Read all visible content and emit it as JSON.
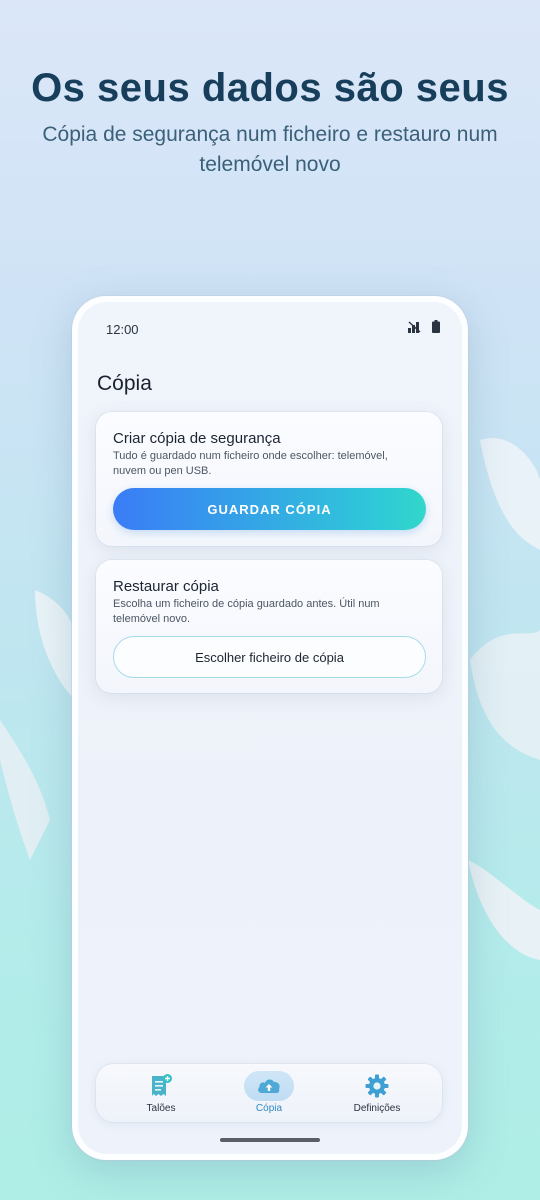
{
  "headline": "Os seus dados são seus",
  "subline": "Cópia de segurança num ficheiro e restauro num telemóvel novo",
  "phone": {
    "status_time": "12:00",
    "status_icons": [
      "signal-icon",
      "battery-icon"
    ],
    "screen_title": "Cópia",
    "cards": {
      "backup": {
        "title": "Criar cópia de segurança",
        "description": "Tudo é guardado num ficheiro onde escolher: telemóvel, nuvem ou pen USB.",
        "button_label": "GUARDAR CÓPIA"
      },
      "restore": {
        "title": "Restaurar cópia",
        "description": "Escolha um ficheiro de cópia guardado antes. Útil num telemóvel novo.",
        "button_label": "Escolher ficheiro de cópia"
      }
    },
    "nav": [
      {
        "label": "Talões",
        "icon": "receipt-icon",
        "active": false
      },
      {
        "label": "Cópia",
        "icon": "cloud-upload-icon",
        "active": true
      },
      {
        "label": "Definições",
        "icon": "gear-icon",
        "active": false
      }
    ]
  },
  "colors": {
    "headline": "#173e5a",
    "primary_gradient_start": "#3a7cf6",
    "primary_gradient_end": "#32d7c9",
    "active_nav": "#2d8ac7"
  }
}
